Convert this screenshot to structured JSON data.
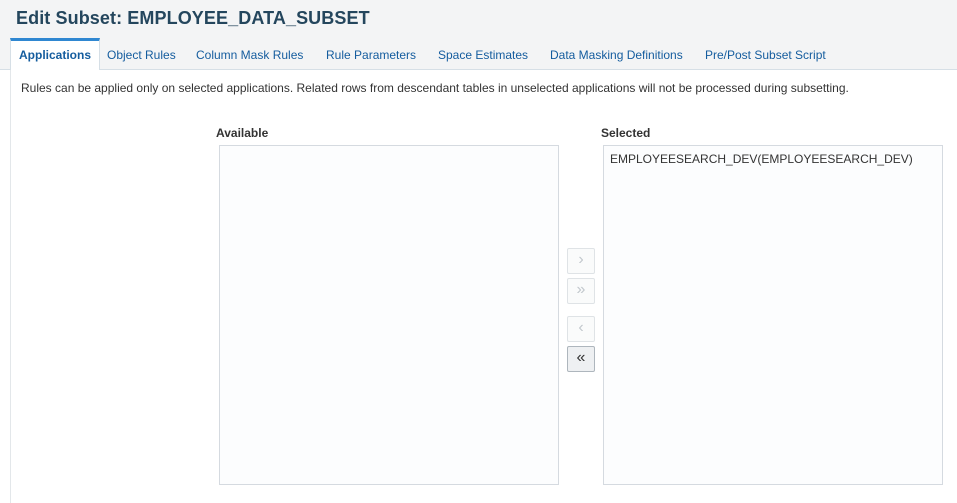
{
  "header": {
    "title": "Edit Subset: EMPLOYEE_DATA_SUBSET"
  },
  "tabs": [
    {
      "label": "Applications",
      "active": true
    },
    {
      "label": "Object Rules",
      "active": false
    },
    {
      "label": "Column Mask Rules",
      "active": false
    },
    {
      "label": "Rule Parameters",
      "active": false
    },
    {
      "label": "Space Estimates",
      "active": false
    },
    {
      "label": "Data Masking Definitions",
      "active": false
    },
    {
      "label": "Pre/Post Subset Script",
      "active": false
    }
  ],
  "applications": {
    "instruction": "Rules can be applied only on selected applications. Related rows from descendant tables in unselected applications will not be processed during subsetting.",
    "available": {
      "label": "Available",
      "items": []
    },
    "selected": {
      "label": "Selected",
      "items": [
        "EMPLOYEESEARCH_DEV(EMPLOYEESEARCH_DEV)"
      ]
    },
    "shuttle": {
      "move_one": {
        "glyph": "›",
        "enabled": false
      },
      "move_all": {
        "glyph": "»",
        "enabled": false
      },
      "remove_one": {
        "glyph": "‹",
        "enabled": false
      },
      "remove_all": {
        "glyph": "«",
        "enabled": true
      }
    }
  }
}
